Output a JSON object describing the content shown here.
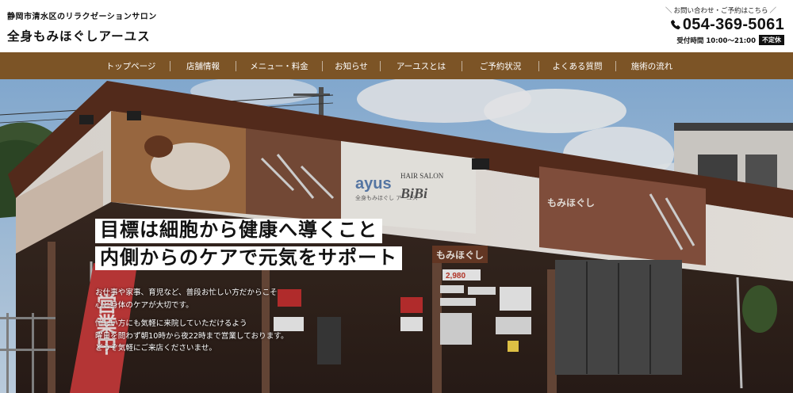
{
  "header": {
    "tagline": "静岡市清水区のリラクゼーションサロン",
    "name": "全身もみほぐしアーユス"
  },
  "contact": {
    "caption": "お問い合わせ・ご予約はこちら",
    "phone": "054-369-5061",
    "hours": "受付時間 10:00〜21:00",
    "closed": "不定休"
  },
  "nav": {
    "items": [
      "トップページ",
      "店舗情報",
      "メニュー・料金",
      "お知らせ",
      "アーユスとは",
      "ご予約状況",
      "よくある質問",
      "施術の流れ"
    ]
  },
  "hero": {
    "headline1": "目標は細胞から健康へ導くこと",
    "headline2": "内側からのケアで元気をサポート",
    "body1": "お仕事や家事、育児など、普段お忙しい方だからこそ",
    "body2": "心と身体のケアが大切です。",
    "body3": "忙しい方にも気軽に来院していただけるよう",
    "body4": "曜日を問わず朝10時から夜22時まで営業しております。",
    "body5": "どうぞ気軽にご来店くださいませ。"
  },
  "storefront": {
    "sign_ayus": "ayus",
    "sign_ayus_sub": "全身もみほぐし アーユス",
    "sign_salon": "HAIR SALON",
    "sign_bibi": "BiBi",
    "sign_momi": "もみほぐし",
    "banner": "営業中",
    "price": "2,980"
  },
  "colors": {
    "nav_bg": "#7c5426",
    "sky": "#9fc3e6",
    "roof": "#5a2e1e"
  }
}
